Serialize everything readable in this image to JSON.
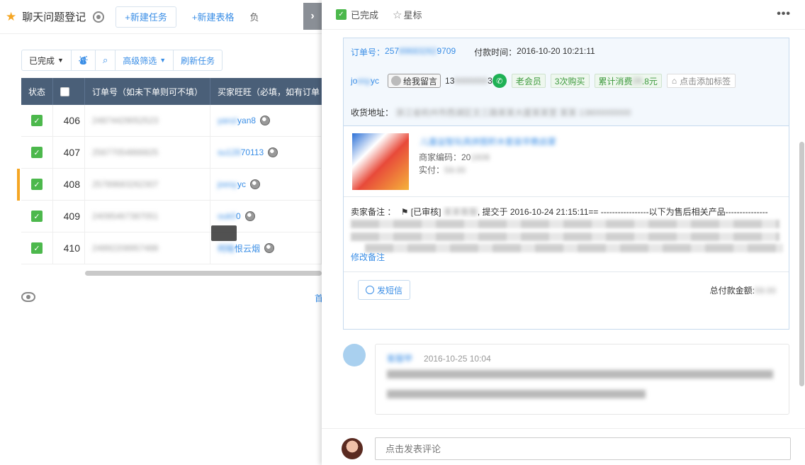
{
  "app": {
    "title_prefix": "",
    "title": "聊天问题登记",
    "new_task": "+新建任务",
    "new_form": "+新建表格",
    "more_label": "负"
  },
  "toolbar": {
    "filter_status": "已完成",
    "advanced_filter": "高级筛选",
    "refresh": "刷新任务"
  },
  "table": {
    "headers": [
      "状态",
      "",
      "订单号（如未下单则可不填）",
      "买家旺旺（必填，如有订单"
    ],
    "rows": [
      {
        "id": "406",
        "order": "24874429052523",
        "buyer_blur": "yanzi",
        "buyer_tail": "yan8"
      },
      {
        "id": "407",
        "order": "25677054866825",
        "buyer_blur": "su128",
        "buyer_tail": "70113"
      },
      {
        "id": "408",
        "order": "25789683262307",
        "buyer_blur": "joesy",
        "buyer_tail": "yc"
      },
      {
        "id": "409",
        "order": "24095467387051",
        "buyer_blur": "ouk0",
        "buyer_tail": "0"
      },
      {
        "id": "410",
        "order": "24892208957488",
        "buyer_blur": "柯暗",
        "buyer_tail": "恨云烟"
      }
    ],
    "pager_label": "首"
  },
  "panel": {
    "done_label": "已完成",
    "star_label": "星标",
    "more": "•••",
    "order_label": "订单号：",
    "order_prefix": "257",
    "order_mid": "89683262",
    "order_suffix": "9709",
    "pay_time_label": "付款时间：",
    "pay_time": "2016-10-20 10:21:11",
    "buyer_prefix": "jo",
    "buyer_mid": "esy",
    "buyer_suffix": "yc",
    "message_button": "给我留言",
    "phone_prefix": "13",
    "phone_mid": "8888888",
    "phone_suffix": "3",
    "tags": [
      "老会员",
      "3次购买"
    ],
    "spend_prefix": "累计消费",
    "spend_mid": "28",
    "spend_suffix": ".8元",
    "add_tag": "点击添加标签",
    "address_label": "收货地址：",
    "address_value": "浙江省杭州市西湖区文三路某某大厦某某室 某某 13800000000",
    "product_title": "儿童益智玩具拼图积木套装早教启蒙",
    "sku_label": "商家编码：20",
    "sku_blur": "1608",
    "paid_label": "实付：",
    "paid_blur": "59.00",
    "remark_label": "卖家备注 ：",
    "remark_audit": "[已审核]",
    "remark_user": "某某客服",
    "remark_text": ", 提交于 2016-10-24 21:15:11== -----------------以下为售后相关产品---------------",
    "edit_remark": "修改备注",
    "sms_button": "发短信",
    "total_label": "总付款金额:",
    "total_blur": "59.00",
    "comment_user": "客服甲",
    "comment_time": "2016-10-25 10:04",
    "comment_placeholder": "点击发表评论"
  },
  "colors": {
    "accent": "#3a8ee6",
    "done_green": "#4cb84c",
    "header_bg": "#4a5f78",
    "selected_row": "#f5a623"
  }
}
